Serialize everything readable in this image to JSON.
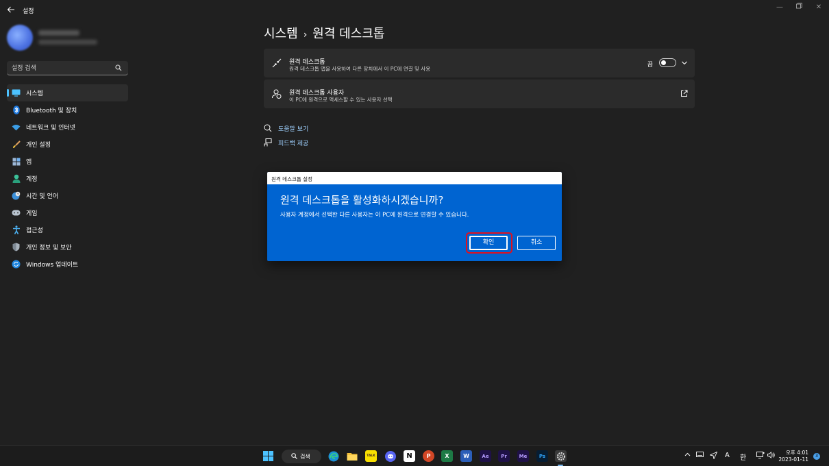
{
  "window": {
    "title": "설정"
  },
  "search": {
    "placeholder": "설정 검색"
  },
  "nav": [
    {
      "label": "시스템",
      "icon": "monitor-icon",
      "active": true
    },
    {
      "label": "Bluetooth 및 장치",
      "icon": "bluetooth-icon"
    },
    {
      "label": "네트워크 및 인터넷",
      "icon": "wifi-icon"
    },
    {
      "label": "개인 설정",
      "icon": "brush-icon"
    },
    {
      "label": "앱",
      "icon": "apps-icon"
    },
    {
      "label": "계정",
      "icon": "person-icon"
    },
    {
      "label": "시간 및 언어",
      "icon": "globe-clock-icon"
    },
    {
      "label": "게임",
      "icon": "gamepad-icon"
    },
    {
      "label": "접근성",
      "icon": "accessibility-icon"
    },
    {
      "label": "개인 정보 및 보안",
      "icon": "shield-icon"
    },
    {
      "label": "Windows 업데이트",
      "icon": "update-icon"
    }
  ],
  "breadcrumb": {
    "parent": "시스템",
    "separator": "›",
    "current": "원격 데스크톱"
  },
  "cards": {
    "remote_desktop": {
      "title": "원격 데스크톱",
      "subtitle": "원격 데스크톱 앱을 사용하여 다른 장치에서 이 PC에 연결 및 사용",
      "toggle_label": "끔",
      "toggle_on": false
    },
    "remote_users": {
      "title": "원격 데스크톱 사용자",
      "subtitle": "이 PC에 원격으로 액세스할 수 있는 사용자 선택"
    }
  },
  "links": {
    "help": "도움말 보기",
    "feedback": "피드백 제공"
  },
  "dialog": {
    "window_title": "원격 데스크톱 설정",
    "heading": "원격 데스크톱을 활성화하시겠습니까?",
    "text": "사용자 계정에서 선택한 다른 사용자는 이 PC에 원격으로 연결할 수 있습니다.",
    "confirm": "확인",
    "cancel": "취소"
  },
  "taskbar": {
    "search_label": "검색",
    "apps": [
      "start-icon",
      "edge-icon",
      "file-explorer-icon",
      "kakaotalk-icon",
      "discord-icon",
      "notion-icon",
      "powerpoint-icon",
      "excel-icon",
      "word-icon",
      "after-effects-icon",
      "premiere-icon",
      "media-encoder-icon",
      "photoshop-icon",
      "settings-icon"
    ],
    "app_labels": {
      "ae": "Ae",
      "pr": "Pr",
      "me": "Me",
      "ps": "Ps",
      "notion": "N",
      "ppt": "P",
      "excel": "X",
      "word": "W",
      "kakao": "TALK"
    },
    "tray": {
      "ime_a": "A",
      "ime_han": "한"
    },
    "clock": {
      "time": "오후 4:01",
      "date": "2023-01-11"
    },
    "notification_count": "3"
  },
  "colors": {
    "accent": "#4cc2ff",
    "dialog_bg": "#0064d1",
    "highlight": "#e0101e",
    "link": "#9fd1ff"
  }
}
